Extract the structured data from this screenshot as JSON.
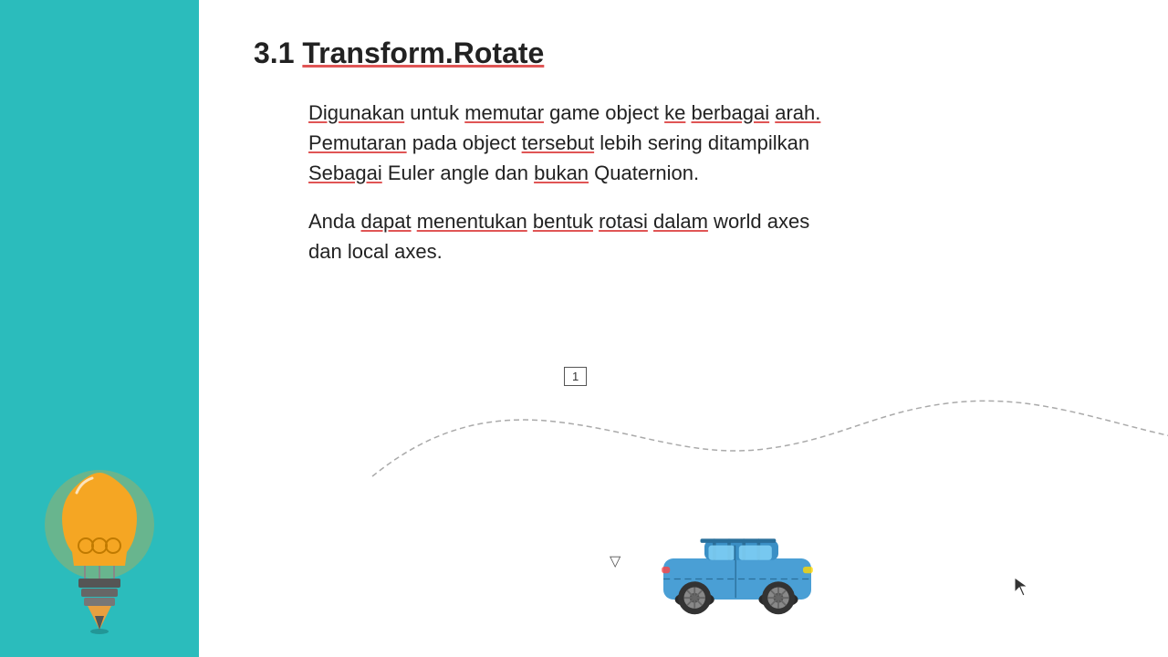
{
  "sidebar": {
    "bg_color": "#2bbcbc"
  },
  "slide": {
    "title_prefix": "3.1 ",
    "title_main": "Transform.Rotate",
    "paragraph1_parts": [
      {
        "text": "Digunakan",
        "underline": true
      },
      {
        "text": " untuk ",
        "underline": false
      },
      {
        "text": "memutar",
        "underline": true
      },
      {
        "text": " game object ",
        "underline": false
      },
      {
        "text": "ke",
        "underline": true
      },
      {
        "text": " ",
        "underline": false
      },
      {
        "text": "berbagai",
        "underline": true
      },
      {
        "text": " ",
        "underline": false
      },
      {
        "text": "arah.",
        "underline": true
      },
      {
        "text": " ",
        "underline": false
      },
      {
        "text": "Pemutaran",
        "underline": true
      },
      {
        "text": " pada object ",
        "underline": false
      },
      {
        "text": "tersebut",
        "underline": true
      },
      {
        "text": " lebih sering ditampilkan",
        "underline": false
      }
    ],
    "paragraph1_line2_parts": [
      {
        "text": "Sebagai",
        "underline": true
      },
      {
        "text": " Euler angle dan ",
        "underline": false
      },
      {
        "text": "bukan",
        "underline": true
      },
      {
        "text": " Quaternion.",
        "underline": false
      }
    ],
    "paragraph2_parts": [
      {
        "text": "Anda ",
        "underline": false
      },
      {
        "text": "dapat",
        "underline": true
      },
      {
        "text": " ",
        "underline": false
      },
      {
        "text": "menentukan",
        "underline": true
      },
      {
        "text": " ",
        "underline": false
      },
      {
        "text": "bentuk",
        "underline": true
      },
      {
        "text": " ",
        "underline": false
      },
      {
        "text": "rotasi",
        "underline": true
      },
      {
        "text": " ",
        "underline": false
      },
      {
        "text": "dalam",
        "underline": true
      },
      {
        "text": " world axes",
        "underline": false
      }
    ],
    "paragraph2_line2": "dan local axes.",
    "number_box": "1",
    "arrow": "▽"
  }
}
